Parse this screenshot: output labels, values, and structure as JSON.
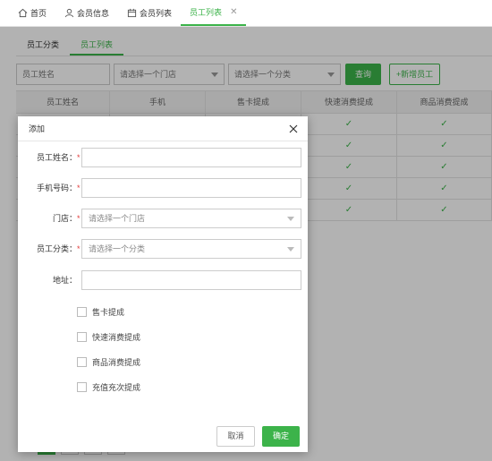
{
  "top_tabs": [
    {
      "label": "首页",
      "icon": "home-icon"
    },
    {
      "label": "会员信息",
      "icon": "user-icon"
    },
    {
      "label": "会员列表",
      "icon": "calendar-icon"
    },
    {
      "label": "员工列表",
      "close": "✕"
    }
  ],
  "sub_tabs": [
    "员工分类",
    "员工列表"
  ],
  "filters": {
    "name_placeholder": "员工姓名",
    "store_select": "请选择一个门店",
    "category_select": "请选择一个分类",
    "query_button": "查询",
    "add_button": "+新增员工"
  },
  "table": {
    "headers": [
      "员工姓名",
      "手机",
      "售卡提成",
      "快速消费提成",
      "商品消费提成"
    ],
    "rows": [
      [
        "",
        "",
        "",
        "✓",
        "✓"
      ],
      [
        "",
        "",
        "",
        "✓",
        "✓"
      ],
      [
        "",
        "",
        "",
        "✓",
        "✓"
      ],
      [
        "",
        "",
        "",
        "✓",
        "✓"
      ],
      [
        "",
        "",
        "",
        "✓",
        "✓"
      ]
    ]
  },
  "modal": {
    "title": "添加",
    "close": "×",
    "required_mark": "*",
    "fields": {
      "name_label": "员工姓名：",
      "phone_label": "手机号码：",
      "store_label": "门店：",
      "store_placeholder": "请选择一个门店",
      "category_label": "员工分类：",
      "category_placeholder": "请选择一个分类",
      "address_label": "地址："
    },
    "checkboxes": [
      "售卡提成",
      "快速消费提成",
      "商品消费提成",
      "充值充次提成"
    ],
    "cancel": "取消",
    "confirm": "确定"
  },
  "colors": {
    "accent": "#3cb34a",
    "required": "#e03c3c"
  }
}
